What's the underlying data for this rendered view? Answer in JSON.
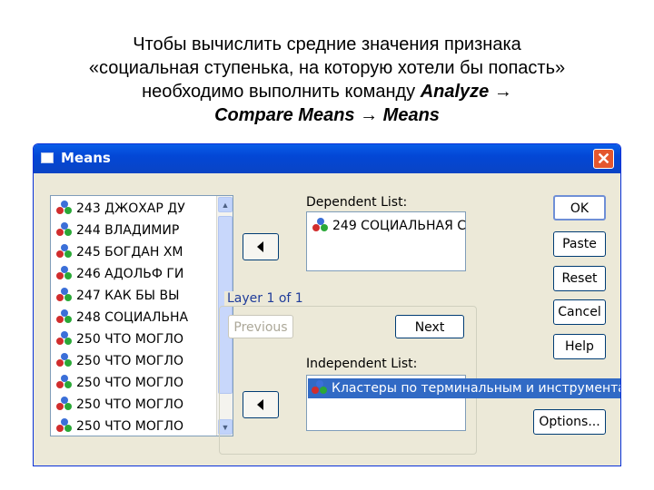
{
  "slide": {
    "line1": "Чтобы вычислить средние значения признака",
    "line2": "«социальная ступенька, на которую хотели бы попасть»",
    "line3_prefix": "необходимо выполнить команду ",
    "line3_cmd": "Analyze →",
    "line4": "Compare Means → Means"
  },
  "dialog": {
    "title": "Means",
    "close_glyph": "✕",
    "variables": [
      "243  ДЖОХАР ДУ",
      "244  ВЛАДИМИР",
      "245  БОГДАН ХМ",
      "246  АДОЛЬФ ГИ",
      "247  КАК БЫ ВЫ",
      "248  СОЦИАЛЬНА",
      "250  ЧТО МОГЛО",
      "250  ЧТО МОГЛО",
      "250  ЧТО МОГЛО",
      "250  ЧТО МОГЛО",
      "250  ЧТО МОГЛО"
    ],
    "dependent_label": "Dependent List:",
    "dependent_item": "249  СОЦИАЛЬНАЯ С",
    "layer_label": "Layer 1 of 1",
    "previous_label": "Previous",
    "next_label": "Next",
    "independent_label": "Independent List:",
    "independent_item": "Кластеры по терминальным и инструментальн",
    "buttons": {
      "ok": "OK",
      "paste": "Paste",
      "reset": "Reset",
      "cancel": "Cancel",
      "help": "Help",
      "options": "Options..."
    },
    "icons": {
      "variable": "variable-balls-icon",
      "move": "left-arrow-icon",
      "scroll_up": "scroll-up-icon",
      "scroll_down": "scroll-down-icon"
    }
  }
}
